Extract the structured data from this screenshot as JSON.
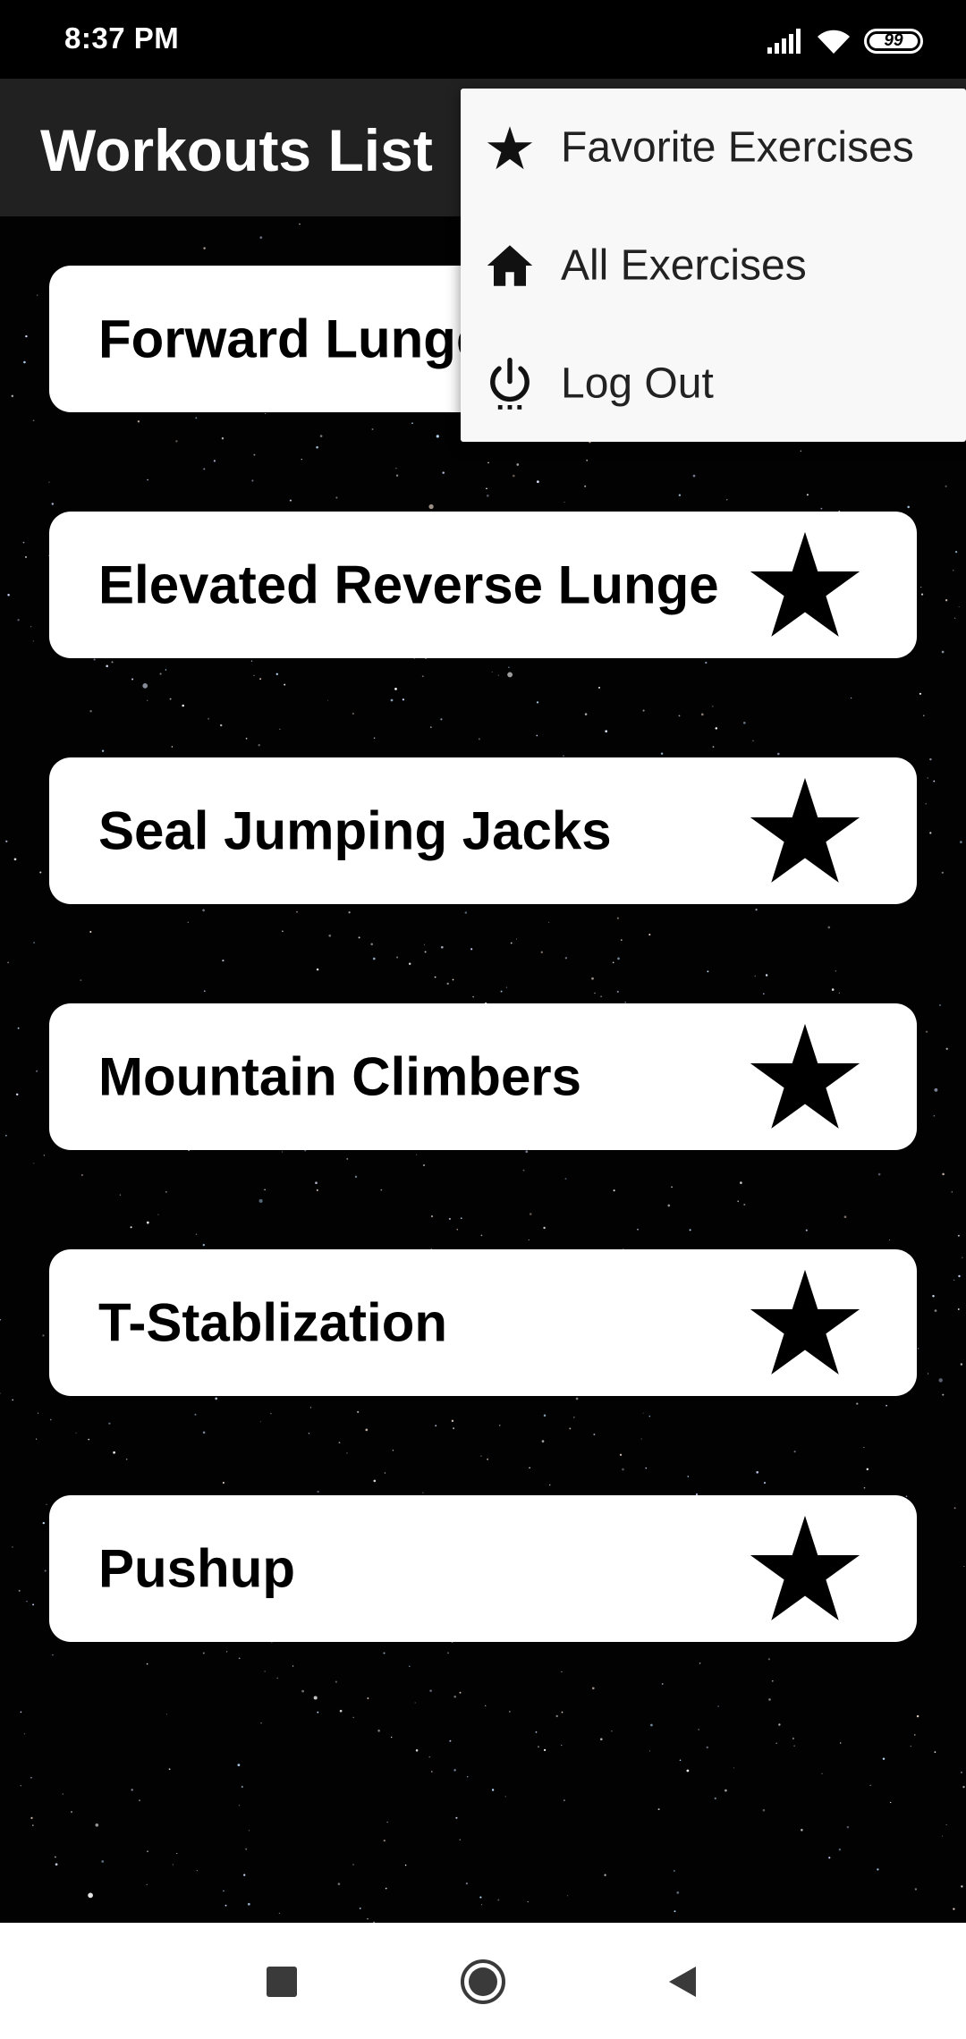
{
  "status_bar": {
    "time": "8:37 PM",
    "battery_level": "99",
    "icons": [
      "signal-icon",
      "wifi-icon",
      "battery-icon"
    ]
  },
  "app_bar": {
    "title": "Workouts List"
  },
  "workouts": [
    {
      "name": "Forward Lunge",
      "icon": "star-icon"
    },
    {
      "name": "Elevated Reverse Lunge",
      "icon": "star-icon"
    },
    {
      "name": "Seal Jumping Jacks",
      "icon": "star-icon"
    },
    {
      "name": "Mountain Climbers",
      "icon": "star-icon"
    },
    {
      "name": "T-Stablization",
      "icon": "star-icon"
    },
    {
      "name": "Pushup",
      "icon": "star-icon"
    }
  ],
  "menu": {
    "items": [
      {
        "label": "Favorite Exercises",
        "icon": "star-icon"
      },
      {
        "label": "All Exercises",
        "icon": "home-icon"
      },
      {
        "label": "Log Out",
        "icon": "power-icon"
      }
    ]
  },
  "nav_bar": {
    "buttons": [
      "recents-square-icon",
      "home-circle-icon",
      "back-triangle-icon"
    ]
  },
  "colors": {
    "background": "#000000",
    "app_bar": "#212121",
    "card": "#ffffff",
    "menu": "#f8f8f8",
    "text_dark": "#000000",
    "text_light": "#ffffff"
  }
}
